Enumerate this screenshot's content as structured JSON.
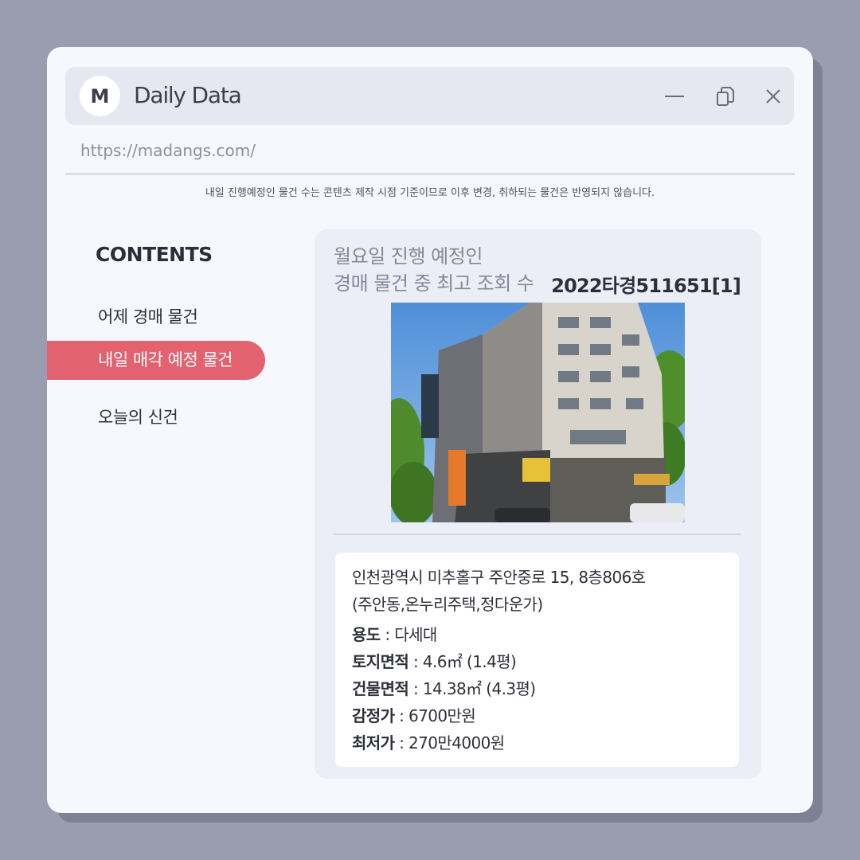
{
  "app": {
    "logo_letter": "M",
    "title": "Daily Data",
    "url": "https://madangs.com/"
  },
  "notice": "내일 진행예정인 물건 수는 콘텐츠 제작 시점 기준이므로 이후 변경, 취하되는 물건은 반영되지 않습니다.",
  "sidebar": {
    "heading": "CONTENTS",
    "items": [
      {
        "label": "어제 경매 물건",
        "active": false
      },
      {
        "label": "내일 매각 예정 물건",
        "active": true
      },
      {
        "label": "오늘의 신건",
        "active": false
      }
    ]
  },
  "card": {
    "heading_line1": "월요일 진행 예정인",
    "heading_line2": "경매 물건 중 최고 조회 수",
    "case_number": "2022타경511651[1]",
    "address_line1": "인천광역시 미추홀구 주안중로 15, 8층806호",
    "address_line2": "(주안동,온누리주택,정다운가)",
    "details": [
      {
        "key": "용도",
        "value": " : 다세대"
      },
      {
        "key": "토지면적",
        "value": " : 4.6㎡ (1.4평)"
      },
      {
        "key": "건물면적",
        "value": " : 14.38㎡ (4.3평)"
      },
      {
        "key": "감정가",
        "value": " : 6700만원"
      },
      {
        "key": "최저가",
        "value": " : 270만4000원"
      }
    ]
  },
  "colors": {
    "accent": "#e2626f",
    "background": "#9a9caf",
    "window": "#f7f8fe"
  }
}
